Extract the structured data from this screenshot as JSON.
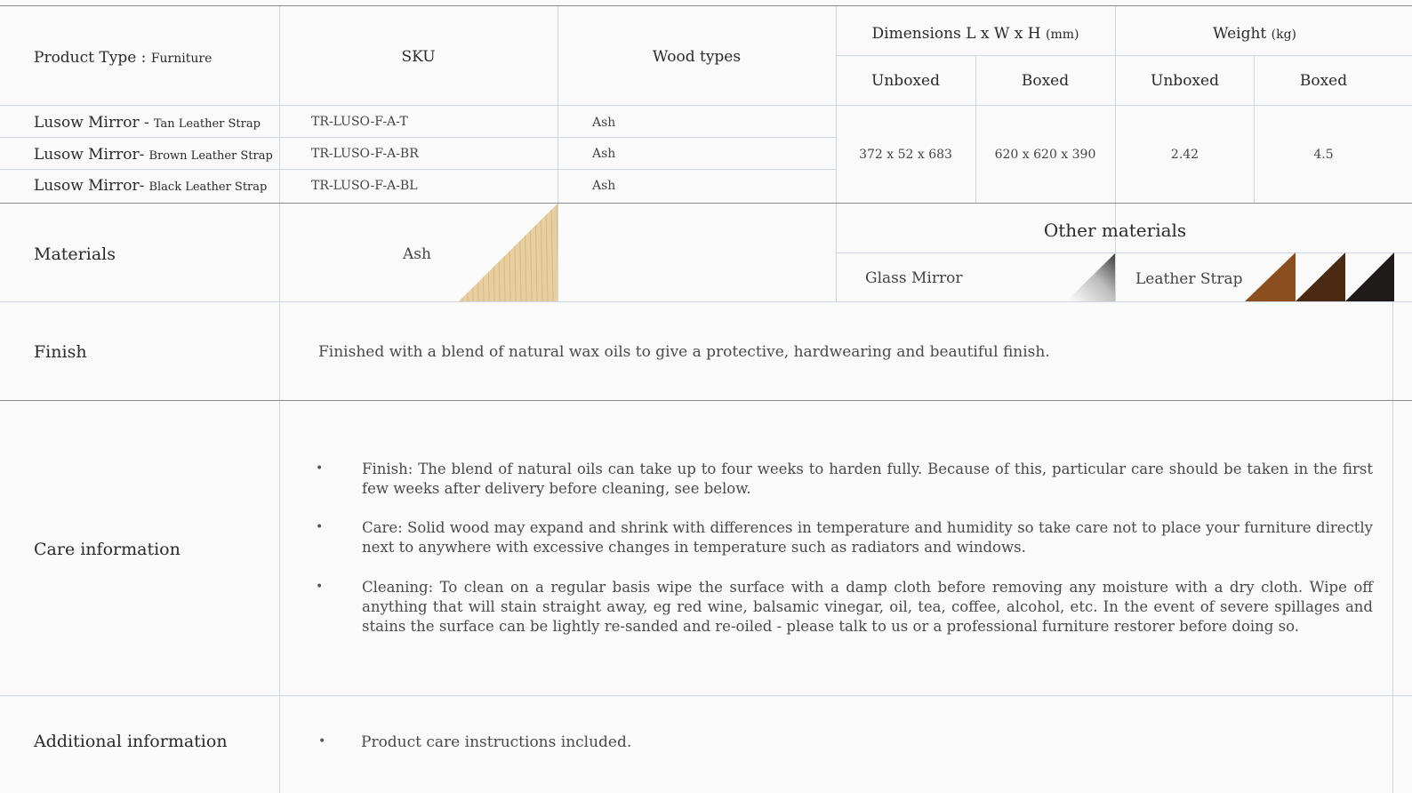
{
  "header": {
    "product_type_label": "Product Type :",
    "product_type_value": "Furniture",
    "sku": "SKU",
    "wood_types": "Wood types",
    "dimensions_label": "Dimensions L x W x H",
    "dimensions_unit": "(mm)",
    "weight_label": "Weight",
    "weight_unit": "(kg)",
    "unboxed": "Unboxed",
    "boxed": "Boxed"
  },
  "products": [
    {
      "name": "Lusow Mirror -",
      "variant": "Tan Leather Strap",
      "sku": "TR-LUSO-F-A-T",
      "wood": "Ash"
    },
    {
      "name": "Lusow Mirror-",
      "variant": "Brown Leather Strap",
      "sku": "TR-LUSO-F-A-BR",
      "wood": "Ash"
    },
    {
      "name": "Lusow Mirror-",
      "variant": "Black Leather Strap",
      "sku": "TR-LUSO-F-A-BL",
      "wood": "Ash"
    }
  ],
  "dimensions": {
    "unboxed": "372 x 52 x 683",
    "boxed": "620 x 620 x 390"
  },
  "weight": {
    "unboxed": "2.42",
    "boxed": "4.5"
  },
  "materials": {
    "label": "Materials",
    "wood": "Ash",
    "other_label": "Other materials",
    "glass": "Glass Mirror",
    "leather": "Leather Strap",
    "swatch_colors": {
      "ash": "#e8cfa0",
      "tan": "#8a4e1f",
      "brown": "#4a2a12",
      "black": "#1f1b1a"
    }
  },
  "finish": {
    "label": "Finish",
    "text": "Finished with a blend of natural wax oils to give a protective, hardwearing and beautiful finish."
  },
  "care": {
    "label": "Care information",
    "items": [
      "Finish: The blend of natural oils can take up to four weeks to harden fully. Because of this, particular care should be taken in the first few weeks after delivery before cleaning, see below.",
      "Care: Solid wood may expand and shrink with differences in temperature and humidity so take care not to place your furniture directly next to anywhere with excessive changes in temperature such as radiators and windows.",
      "Cleaning: To clean on a regular basis wipe the surface with a damp cloth before removing any moisture with a dry cloth. Wipe off anything that will stain straight away, eg red wine, balsamic vinegar, oil, tea, coffee, alcohol, etc. In the event of severe spillages and stains the surface can be lightly re-sanded and re-oiled - please talk to us or a professional furniture restorer before doing so."
    ]
  },
  "additional": {
    "label": "Additional information",
    "items": [
      "Product care instructions included."
    ]
  }
}
